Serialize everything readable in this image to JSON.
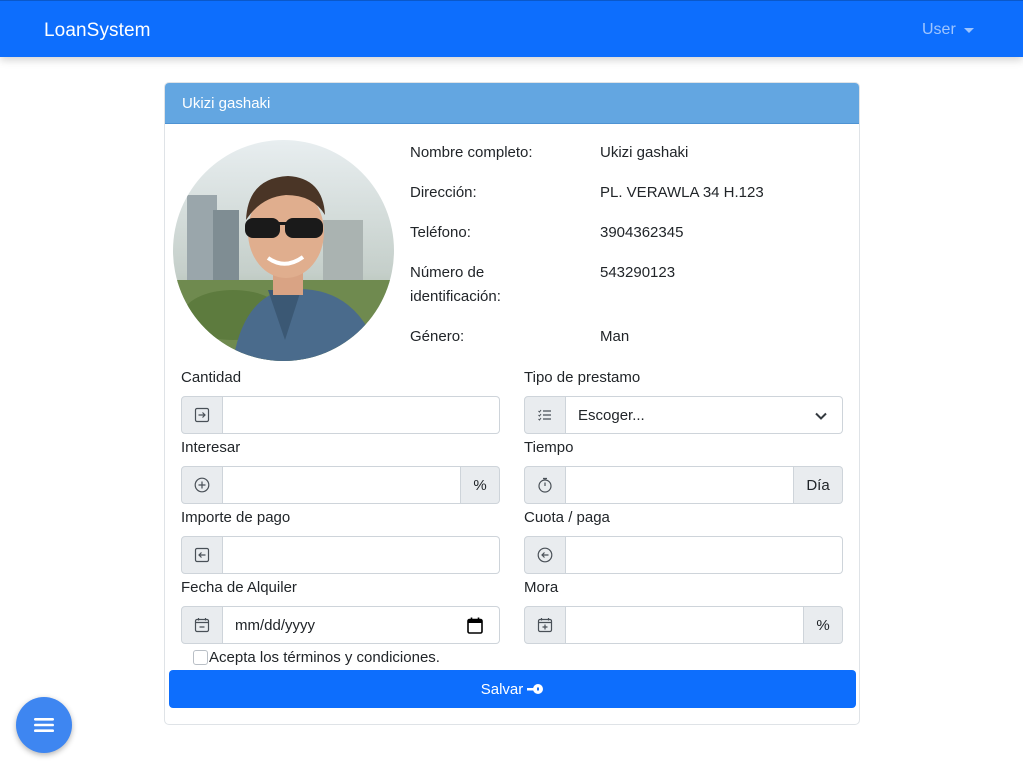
{
  "navbar": {
    "brand": "LoanSystem",
    "user_label": "User"
  },
  "card": {
    "title": "Ukizi gashaki"
  },
  "profile": {
    "fields": [
      {
        "label": "Nombre completo:",
        "value": "Ukizi gashaki"
      },
      {
        "label": "Dirección:",
        "value": "PL. VERAWLA 34 H.123"
      },
      {
        "label": "Teléfono:",
        "value": "3904362345"
      },
      {
        "label": "Número de identificación:",
        "value": "543290123"
      },
      {
        "label": "Género:",
        "value": "Man"
      }
    ]
  },
  "form": {
    "cantidad": {
      "label": "Cantidad",
      "value": ""
    },
    "tipo_prestamo": {
      "label": "Tipo de prestamo",
      "selected": "Escoger..."
    },
    "interesar": {
      "label": "Interesar",
      "value": "",
      "suffix": "%"
    },
    "tiempo": {
      "label": "Tiempo",
      "value": "",
      "suffix": "Día"
    },
    "importe_pago": {
      "label": "Importe de pago",
      "value": ""
    },
    "cuota_paga": {
      "label": "Cuota / paga",
      "value": ""
    },
    "fecha_alquiler": {
      "label": "Fecha de Alquiler",
      "placeholder": "mm/dd/yyyy"
    },
    "mora": {
      "label": "Mora",
      "value": "",
      "suffix": "%"
    },
    "terms_label": "Acepta los términos y condiciones.",
    "save_label": "Salvar"
  },
  "colors": {
    "primary": "#0d6efd",
    "card_header": "#63a6e1",
    "fab": "#3e86f1"
  }
}
